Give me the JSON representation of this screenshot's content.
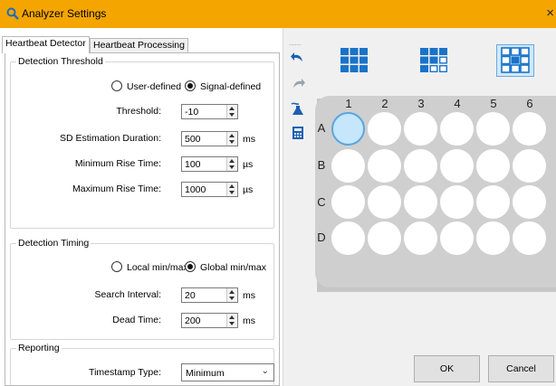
{
  "window": {
    "title": "Analyzer Settings",
    "title_icon": "magnifier-icon",
    "close_glyph": "×"
  },
  "tabs": [
    {
      "label": "Heartbeat Detector",
      "active": true
    },
    {
      "label": "Heartbeat Processing",
      "active": false
    }
  ],
  "detection_threshold": {
    "title": "Detection Threshold",
    "mode_options": [
      {
        "label": "User-defined",
        "checked": false
      },
      {
        "label": "Signal-defined",
        "checked": true
      }
    ],
    "fields": [
      {
        "label": "Threshold:",
        "value": "-10",
        "unit": ""
      },
      {
        "label": "SD Estimation Duration:",
        "value": "500",
        "unit": "ms"
      },
      {
        "label": "Minimum Rise Time:",
        "value": "100",
        "unit": "µs"
      },
      {
        "label": "Maximum Rise Time:",
        "value": "1000",
        "unit": "µs"
      }
    ]
  },
  "detection_timing": {
    "title": "Detection Timing",
    "mode_options": [
      {
        "label": "Local min/max",
        "checked": false
      },
      {
        "label": "Global min/max",
        "checked": true
      }
    ],
    "fields": [
      {
        "label": "Search Interval:",
        "value": "20",
        "unit": "ms"
      },
      {
        "label": "Dead Time:",
        "value": "200",
        "unit": "ms"
      }
    ]
  },
  "reporting": {
    "title": "Reporting",
    "timestamp_label": "Timestamp Type:",
    "timestamp_value": "Minimum"
  },
  "toolbar": {
    "grip": "......",
    "buttons": [
      "undo-icon",
      "redo-icon",
      "flask-icon",
      "calculator-icon"
    ]
  },
  "plate_layouts": [
    {
      "name": "12-well",
      "selected": false
    },
    {
      "name": "6-well",
      "selected": false
    },
    {
      "name": "9-well",
      "selected": true
    }
  ],
  "plate": {
    "columns": [
      "1",
      "2",
      "3",
      "4",
      "5",
      "6"
    ],
    "rows": [
      "A",
      "B",
      "C",
      "D"
    ],
    "selected_well": "A1"
  },
  "buttons": {
    "ok": "OK",
    "cancel": "Cancel"
  },
  "colors": {
    "title_bar": "#f5a500",
    "layout_blue": "#1a73c9",
    "selected_well": "#c6e6fb"
  }
}
